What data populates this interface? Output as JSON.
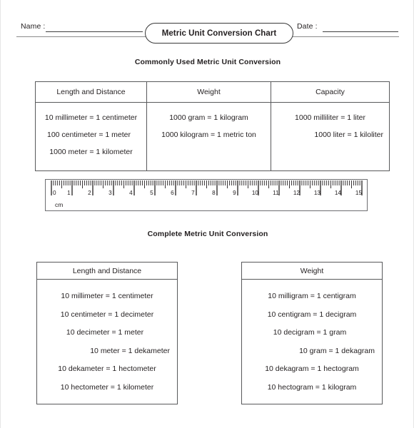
{
  "header": {
    "name_label": "Name :",
    "date_label": "Date :",
    "title": "Metric Unit Conversion Chart"
  },
  "sections": {
    "commonly_used_heading": "Commonly Used Metric Unit Conversion",
    "complete_heading": "Complete Metric Unit Conversion"
  },
  "top_table": {
    "headers": [
      "Length and Distance",
      "Weight",
      "Capacity"
    ],
    "columns": [
      {
        "header": "Length and Distance",
        "rows": [
          "10 millimeter = 1 centimeter",
          "100 centimeter = 1 meter",
          "1000 meter = 1 kilometer"
        ]
      },
      {
        "header": "Weight",
        "rows": [
          "1000 gram = 1 kilogram",
          "1000 kilogram = 1 metric ton"
        ]
      },
      {
        "header": "Capacity",
        "rows": [
          "1000 milliliter = 1 liter",
          "1000 liter = 1 kiloliter"
        ]
      }
    ]
  },
  "ruler": {
    "unit_label": "cm",
    "min": 0,
    "max": 15,
    "tick_numbers": [
      "0",
      "1",
      "2",
      "3",
      "4",
      "5",
      "6",
      "7",
      "8",
      "9",
      "10",
      "11",
      "12",
      "13",
      "14",
      "15"
    ],
    "minor_divisions_per_unit": 10
  },
  "bottom_tables": [
    {
      "header": "Length and Distance",
      "rows": [
        "10 millimeter = 1 centimeter",
        "10 centimeter = 1 decimeter",
        "10 decimeter = 1 meter",
        "10 meter =  1 dekameter",
        "10 dekameter = 1 hectometer",
        "10 hectometer = 1 kilometer"
      ]
    },
    {
      "header": "Weight",
      "rows": [
        "10 milligram = 1 centigram",
        "10 centigram = 1 decigram",
        "10 decigram = 1 gram",
        "10 gram =  1 dekagram",
        "10 dekagram = 1 hectogram",
        "10 hectogram = 1 kilogram"
      ]
    }
  ],
  "colors": {
    "text": "#231f20",
    "border": "#58595b",
    "rule": "#8b8b8b",
    "fill_line": "#3f3f3f"
  }
}
